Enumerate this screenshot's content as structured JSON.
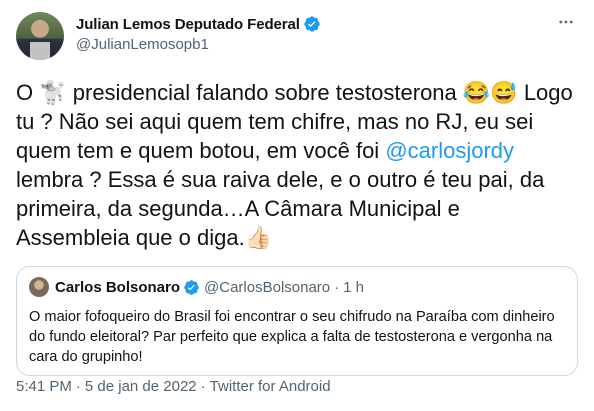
{
  "author": {
    "display_name": "Julian Lemos Deputado Federal",
    "handle": "@JulianLemosopb1",
    "verified": true,
    "avatar_icon": "avatar"
  },
  "more_icon": "more-options-icon",
  "tweet": {
    "segment_1": "O ",
    "emoji_1": "🐩",
    "segment_2": " presidencial falando sobre testosterona ",
    "emoji_2": "😂",
    "emoji_3": "😅",
    "segment_3": " Logo tu ? Não sei aqui quem tem chifre, mas no RJ, eu sei quem tem e quem botou, em você foi ",
    "mention": "@carlosjordy",
    "segment_4": " lembra ? Essa é sua raiva dele, e o outro é teu pai, da primeira, da segunda…A Câmara Municipal e Assembleia que o diga.",
    "emoji_4": "👍🏻"
  },
  "quote": {
    "display_name": "Carlos Bolsonaro",
    "handle": "@CarlosBolsonaro",
    "separator": "·",
    "time": "1 h",
    "verified": true,
    "text": "O maior fofoqueiro do Brasil foi encontrar o seu chifrudo na Paraíba com dinheiro do fundo eleitoral? Par perfeito que explica a falta de testosterona e vergonha na cara do grupinho!"
  },
  "footer": {
    "time": "5:41 PM",
    "dot_1": "·",
    "date": "5 de jan de 2022",
    "dot_2": "·",
    "source": "Twitter for Android"
  },
  "colors": {
    "accent": "#1d9bf0",
    "text": "#0f1419",
    "muted": "#536471",
    "border": "#cfd9de"
  }
}
